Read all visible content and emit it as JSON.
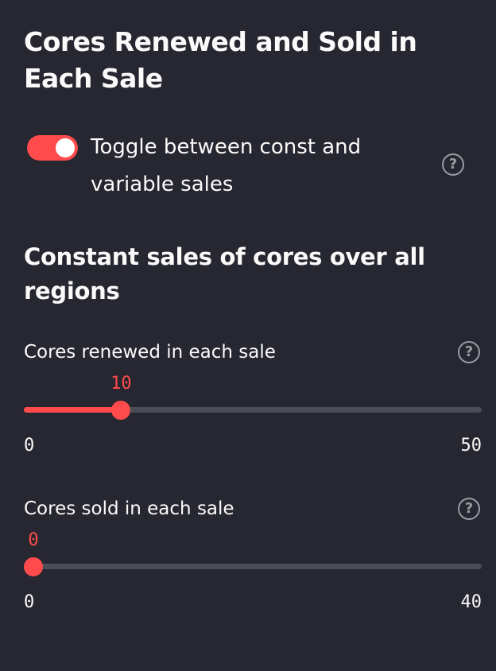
{
  "header": {
    "title": "Cores Renewed and Sold in Each Sale"
  },
  "toggle": {
    "label": "Toggle between const and variable sales",
    "checked": true,
    "help_icon": "question-circle-icon"
  },
  "section": {
    "title": "Constant sales of cores over all regions"
  },
  "sliders": [
    {
      "label": "Cores renewed in each sale",
      "value": "10",
      "min": "0",
      "max": "50",
      "help_icon": "question-circle-icon"
    },
    {
      "label": "Cores sold in each sale",
      "value": "0",
      "min": "0",
      "max": "40",
      "help_icon": "question-circle-icon"
    }
  ],
  "colors": {
    "background": "#262730",
    "accent": "#ff4b4b",
    "text": "#fafafa",
    "track": "#4b4d57",
    "icon": "#9a9ca3"
  }
}
